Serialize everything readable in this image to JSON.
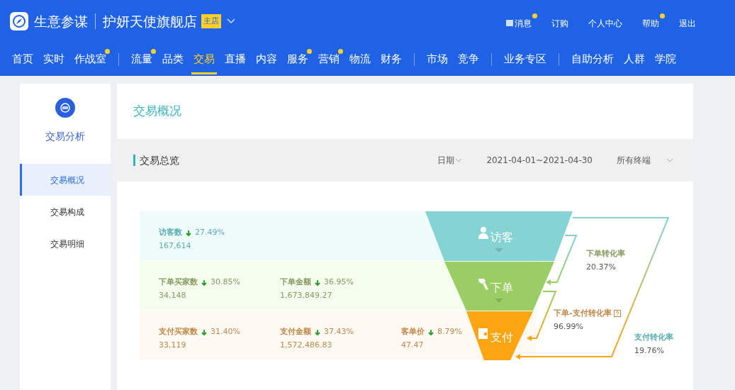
{
  "header": {
    "logo_text": "生意参谋",
    "store_name": "护妍天使旗舰店",
    "store_badge": "主店",
    "top_links": [
      {
        "label": "消息",
        "icon": true,
        "notice": true
      },
      {
        "label": "订购",
        "icon": false,
        "notice": false
      },
      {
        "label": "个人中心",
        "icon": false,
        "notice": false
      },
      {
        "label": "帮助",
        "icon": false,
        "notice": true
      },
      {
        "label": "退出",
        "icon": false,
        "notice": false
      }
    ],
    "nav_groups": [
      [
        {
          "label": "首页",
          "selected": false,
          "notice": false
        },
        {
          "label": "实时",
          "selected": false,
          "notice": false
        },
        {
          "label": "作战室",
          "selected": false,
          "notice": true
        }
      ],
      [
        {
          "label": "流量",
          "selected": false,
          "notice": true
        },
        {
          "label": "品类",
          "selected": false,
          "notice": false
        },
        {
          "label": "交易",
          "selected": true,
          "notice": false
        },
        {
          "label": "直播",
          "selected": false,
          "notice": false
        },
        {
          "label": "内容",
          "selected": false,
          "notice": false
        },
        {
          "label": "服务",
          "selected": false,
          "notice": true
        },
        {
          "label": "营销",
          "selected": false,
          "notice": true
        },
        {
          "label": "物流",
          "selected": false,
          "notice": false
        },
        {
          "label": "财务",
          "selected": false,
          "notice": false
        }
      ],
      [
        {
          "label": "市场",
          "selected": false,
          "notice": false
        },
        {
          "label": "竞争",
          "selected": false,
          "notice": false
        }
      ],
      [
        {
          "label": "业务专区",
          "selected": false,
          "notice": false
        }
      ],
      [
        {
          "label": "自助分析",
          "selected": false,
          "notice": false
        },
        {
          "label": "人群",
          "selected": false,
          "notice": false
        },
        {
          "label": "学院",
          "selected": false,
          "notice": false
        }
      ]
    ]
  },
  "sidebar": {
    "title": "交易分析",
    "items": [
      {
        "label": "交易概况",
        "selected": true
      },
      {
        "label": "交易构成",
        "selected": false
      },
      {
        "label": "交易明细",
        "selected": false
      }
    ]
  },
  "main": {
    "title": "交易概况",
    "section_title": "交易总览",
    "filters": [
      {
        "label": "日期",
        "dropdown": true
      },
      {
        "label": "2021-04-01~2021-04-30",
        "dropdown": false
      },
      {
        "label": "所有终端",
        "dropdown": true
      }
    ],
    "funnel": {
      "stages": [
        {
          "label": "访客",
          "color": "#85d3d3",
          "metrics": [
            {
              "label": "访客数",
              "down": true,
              "change": "27.49%",
              "value": "167,614"
            }
          ]
        },
        {
          "label": "下单",
          "color": "#9acd63",
          "metrics": [
            {
              "label": "下单买家数",
              "down": true,
              "change": "30.85%",
              "value": "34,148"
            },
            {
              "label": "下单金额",
              "down": true,
              "change": "36.95%",
              "value": "1,673,849.27"
            }
          ]
        },
        {
          "label": "支付",
          "color": "#fba512",
          "metrics": [
            {
              "label": "支付买家数",
              "down": true,
              "change": "31.40%",
              "value": "33,119"
            },
            {
              "label": "支付金额",
              "down": true,
              "change": "37.43%",
              "value": "1,572,486.83"
            },
            {
              "label": "客单价",
              "down": true,
              "change": "8.79%",
              "value": "47.47"
            }
          ]
        }
      ],
      "conversions": [
        {
          "label": "下单转化率",
          "value": "20.37%",
          "help": false,
          "color": "#8a9860"
        },
        {
          "label": "下单-支付转化率",
          "value": "96.99%",
          "help": true,
          "color": "#c0894a"
        },
        {
          "label": "支付转化率",
          "value": "19.76%",
          "help": false,
          "color": "#5aaeb0"
        }
      ]
    }
  }
}
